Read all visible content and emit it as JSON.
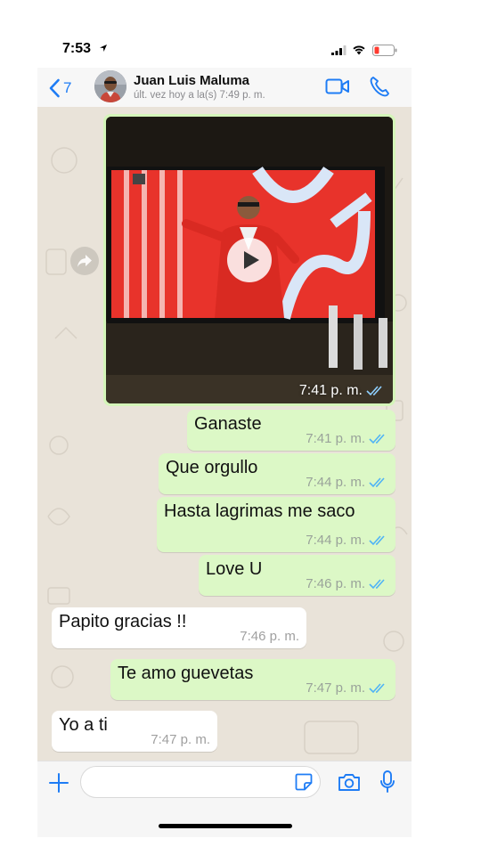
{
  "status_bar": {
    "time": "7:53"
  },
  "header": {
    "back_count": "7",
    "contact_name": "Juan Luis Maluma",
    "contact_status": "últ. vez hoy a la(s) 7:49 p. m."
  },
  "video_message": {
    "time": "7:41 p. m.",
    "status": "read"
  },
  "messages": [
    {
      "direction": "outgoing",
      "text": "Ganaste",
      "time": "7:41 p. m.",
      "status": "read"
    },
    {
      "direction": "outgoing",
      "text": "Que orgullo",
      "time": "7:44 p. m.",
      "status": "read"
    },
    {
      "direction": "outgoing",
      "text": "Hasta lagrimas me saco",
      "time": "7:44 p. m.",
      "status": "read"
    },
    {
      "direction": "outgoing",
      "text": "Love U",
      "time": "7:46 p. m.",
      "status": "read"
    },
    {
      "direction": "incoming",
      "text": "Papito gracias !!",
      "time": "7:46 p. m."
    },
    {
      "direction": "outgoing",
      "text": "Te amo guevetas",
      "time": "7:47 p. m.",
      "status": "read"
    },
    {
      "direction": "incoming",
      "text": "Yo a ti",
      "time": "7:47 p. m."
    }
  ],
  "input": {
    "placeholder": ""
  },
  "colors": {
    "accent": "#1e7cf5",
    "outgoing_bubble": "#dcf8c6",
    "incoming_bubble": "#ffffff",
    "read_ticks": "#4fb3f6",
    "chat_background": "#e9e3d9"
  },
  "icons": [
    "location-arrow-icon",
    "signal-icon",
    "wifi-icon",
    "battery-icon",
    "back-chevron-icon",
    "video-call-icon",
    "phone-icon",
    "play-icon",
    "forward-icon",
    "double-check-icon",
    "plus-icon",
    "sticker-icon",
    "camera-icon",
    "microphone-icon"
  ]
}
